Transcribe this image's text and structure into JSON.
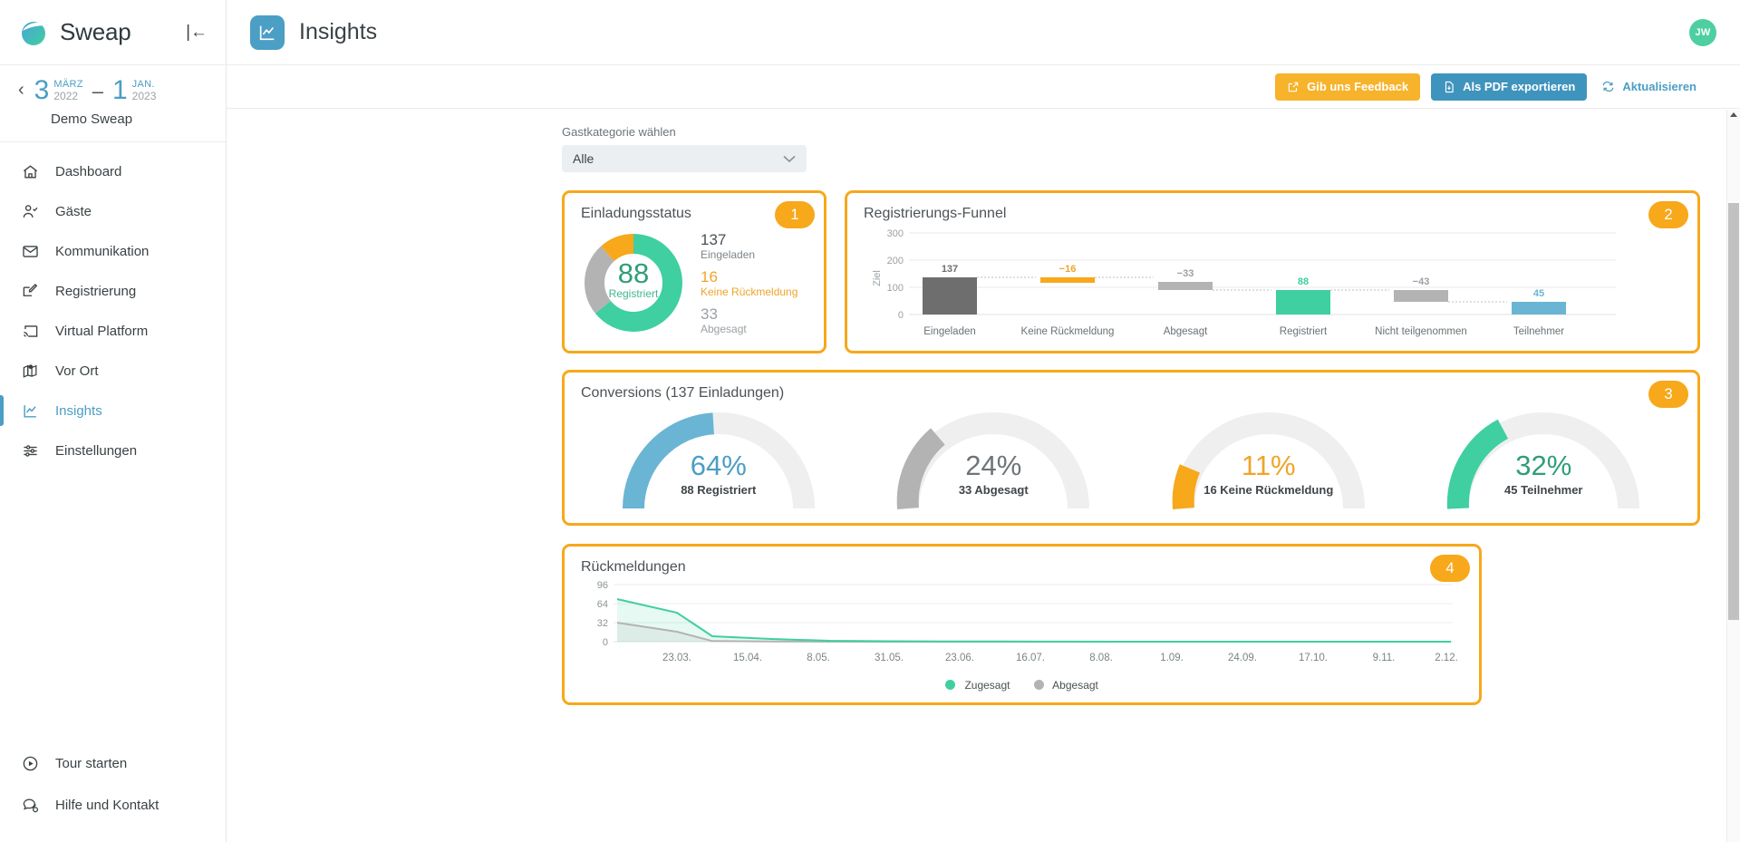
{
  "sidebar": {
    "brand": "Sweap",
    "collapse_icon": "collapse-left-icon",
    "event": {
      "back_icon": "chevron-left-icon",
      "start_day": "3",
      "start_month": "MÄRZ",
      "start_year": "2022",
      "dash": "–",
      "end_day": "1",
      "end_month": "JAN.",
      "end_year": "2023",
      "name": "Demo Sweap"
    },
    "items": [
      {
        "label": "Dashboard",
        "icon": "home-icon",
        "active": false
      },
      {
        "label": "Gäste",
        "icon": "user-check-icon",
        "active": false
      },
      {
        "label": "Kommunikation",
        "icon": "envelope-icon",
        "active": false
      },
      {
        "label": "Registrierung",
        "icon": "form-edit-icon",
        "active": false
      },
      {
        "label": "Virtual Platform",
        "icon": "cast-screen-icon",
        "active": false
      },
      {
        "label": "Vor Ort",
        "icon": "map-pin-icon",
        "active": false
      },
      {
        "label": "Insights",
        "icon": "chart-line-icon",
        "active": true
      },
      {
        "label": "Einstellungen",
        "icon": "sliders-icon",
        "active": false
      }
    ],
    "bottom_items": [
      {
        "label": "Tour starten",
        "icon": "play-circle-icon"
      },
      {
        "label": "Hilfe und Kontakt",
        "icon": "chat-help-icon"
      }
    ]
  },
  "topbar": {
    "page_icon": "chart-line-icon",
    "title": "Insights",
    "avatar_initials": "JW"
  },
  "actions": {
    "feedback_label": "Gib uns Feedback",
    "feedback_icon": "external-link-icon",
    "pdf_label": "Als PDF exportieren",
    "pdf_icon": "file-download-icon",
    "refresh_label": "Aktualisieren",
    "refresh_icon": "refresh-icon"
  },
  "filter": {
    "label": "Gastkategorie wählen",
    "value": "Alle",
    "chevron_icon": "chevron-down-icon"
  },
  "cards": {
    "status": {
      "title": "Einladungsstatus",
      "badge": "1"
    },
    "funnel": {
      "title": "Registrierungs-Funnel",
      "badge": "2"
    },
    "conversions": {
      "title": "Conversions (137 Einladungen)",
      "badge": "3"
    },
    "feedback": {
      "title": "Rückmeldungen",
      "badge": "4"
    }
  },
  "colors": {
    "accent_orange": "#f7a81b",
    "blue": "#4b9ec4",
    "green": "#3fcfa0",
    "grey": "#b3b3b3",
    "dark_grey": "#6e6e6e"
  },
  "chart_data": [
    {
      "type": "pie",
      "title": "Einladungsstatus",
      "center_value": "88",
      "center_label": "Registriert",
      "categories": [
        "Registriert",
        "Abgesagt",
        "Keine Rückmeldung"
      ],
      "values": [
        88,
        33,
        16
      ],
      "colors": [
        "#3fcfa0",
        "#b3b3b3",
        "#f7a81b"
      ],
      "legend": [
        {
          "value": "137",
          "label": "Eingeladen",
          "style": "dark"
        },
        {
          "value": "16",
          "label": "Keine Rückmeldung",
          "style": "orange"
        },
        {
          "value": "33",
          "label": "Abgesagt",
          "style": "grey"
        }
      ]
    },
    {
      "type": "bar",
      "title": "Registrierungs-Funnel",
      "subtype": "waterfall",
      "ylabel": "Ziel",
      "xlabel": "",
      "ylim": [
        0,
        300
      ],
      "yticks": [
        0,
        100,
        200,
        300
      ],
      "grid": true,
      "categories": [
        "Eingeladen",
        "Keine Rückmeldung",
        "Abgesagt",
        "Registriert",
        "Nicht teilgenommen",
        "Teilnehmer"
      ],
      "labels": [
        "137",
        "−16",
        "−33",
        "88",
        "−43",
        "45"
      ],
      "values": [
        137,
        -16,
        -33,
        88,
        -43,
        45
      ],
      "bar_bottom": [
        0,
        121,
        88,
        0,
        45,
        0
      ],
      "bar_top": [
        137,
        137,
        121,
        88,
        88,
        45
      ],
      "bar_colors": [
        "#6e6e6e",
        "#f7a81b",
        "#b3b3b3",
        "#3fcfa0",
        "#b3b3b3",
        "#6ab5d4"
      ],
      "label_colors": [
        "#6e6e6e",
        "#f0a429",
        "#9aa1a5",
        "#3fcfa0",
        "#9aa1a5",
        "#6ab5d4"
      ]
    },
    {
      "type": "pie",
      "subtype": "gauges",
      "title": "Conversions (137 Einladungen)",
      "total": 137,
      "gauges": [
        {
          "pct": "64%",
          "value": 64,
          "sub": "88 Registriert",
          "color": "#6ab5d4"
        },
        {
          "pct": "24%",
          "value": 24,
          "sub": "33 Abgesagt",
          "color": "#b3b3b3"
        },
        {
          "pct": "11%",
          "value": 11,
          "sub": "16 Keine Rückmeldung",
          "color": "#f7a81b"
        },
        {
          "pct": "32%",
          "value": 32,
          "sub": "45 Teilnehmer",
          "color": "#3fcfa0"
        }
      ]
    },
    {
      "type": "area",
      "title": "Rückmeldungen",
      "ylim": [
        0,
        96
      ],
      "yticks": [
        0,
        32,
        64,
        96
      ],
      "grid": true,
      "legend_position": "bottom",
      "x": [
        "23.03.",
        "15.04.",
        "8.05.",
        "31.05.",
        "23.06.",
        "16.07.",
        "8.08.",
        "1.09.",
        "24.09.",
        "17.10.",
        "9.11.",
        "2.12."
      ],
      "series": [
        {
          "name": "Zugesagt",
          "color": "#3fcfa0",
          "values": [
            71,
            48,
            9,
            5,
            3,
            1,
            1,
            1,
            1,
            1,
            1,
            0,
            1,
            0
          ]
        },
        {
          "name": "Abgesagt",
          "color": "#b3b3b3",
          "values": [
            33,
            17,
            1,
            1,
            0,
            0,
            0,
            0,
            0,
            0,
            0,
            0,
            0,
            0
          ]
        }
      ]
    }
  ]
}
